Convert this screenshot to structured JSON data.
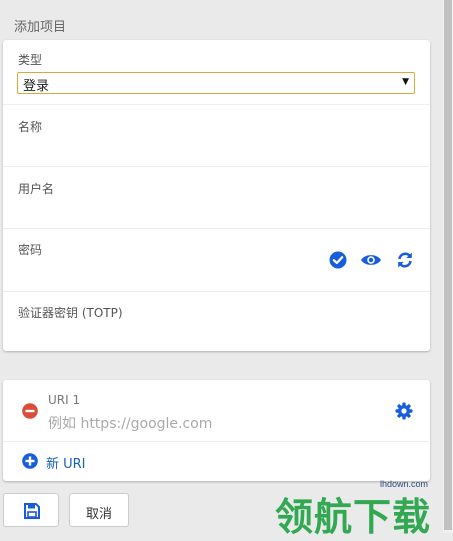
{
  "section_title": "添加项目",
  "main_card": {
    "type_label": "类型",
    "type_value": "登录",
    "name_label": "名称",
    "username_label": "用户名",
    "password_label": "密码",
    "totp_label": "验证器密钥 (TOTP)"
  },
  "uri_card": {
    "uri_label": "URI 1",
    "uri_placeholder": "例如 https://google.com",
    "new_uri_label": "新 URI"
  },
  "buttons": {
    "cancel_label": "取消"
  },
  "watermark": {
    "url": "lhdown.com",
    "text": "领航下载"
  },
  "colors": {
    "accent_blue": "#175ddc",
    "remove_red": "#dd4b39",
    "select_border": "#d9a93a"
  },
  "icons": [
    "check-circle-icon",
    "eye-icon",
    "refresh-icon",
    "minus-circle-icon",
    "gear-icon",
    "plus-circle-icon",
    "save-icon"
  ]
}
